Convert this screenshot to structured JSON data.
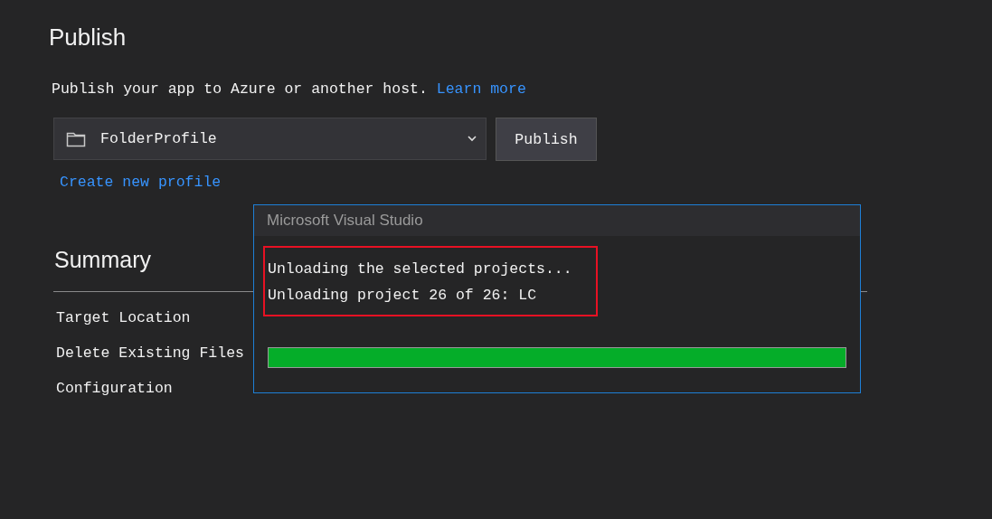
{
  "page": {
    "title": "Publish",
    "description": "Publish your app to Azure or another host.",
    "learn_more": "Learn more"
  },
  "profile_select": {
    "value": "FolderProfile"
  },
  "publish_button": "Publish",
  "create_profile_link": "Create new profile",
  "summary": {
    "title": "Summary",
    "rows": [
      {
        "label": "Target Location"
      },
      {
        "label": "Delete Existing Files"
      },
      {
        "label": "Configuration"
      }
    ]
  },
  "dialog": {
    "title": "Microsoft Visual Studio",
    "lines": [
      "Unloading the selected projects...",
      "Unloading project 26 of 26: LC"
    ],
    "progress": {
      "level": 1
    }
  }
}
